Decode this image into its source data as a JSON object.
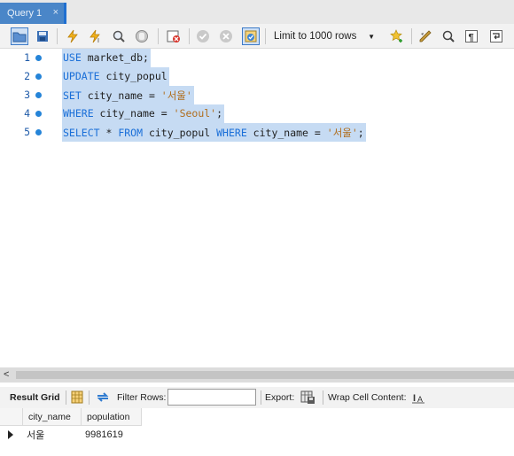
{
  "tab": {
    "title": "Query 1",
    "close": "×"
  },
  "toolbar": {
    "limit_label": "Limit to 1000 rows",
    "icons": [
      "open-folder-icon",
      "save-icon",
      "execute-icon",
      "execute-current-icon",
      "explain-icon",
      "stop-icon",
      "toggle-error-icon",
      "commit-icon",
      "rollback-icon",
      "autocommit-icon",
      "add-snippet-icon",
      "beautify-icon",
      "find-icon",
      "invisible-chars-icon",
      "wrap-icon"
    ]
  },
  "editor": {
    "lines": [
      {
        "num": "1",
        "tokens": [
          {
            "t": "USE",
            "c": "kw"
          },
          {
            "t": " market_db;",
            "c": ""
          }
        ]
      },
      {
        "num": "2",
        "tokens": [
          {
            "t": "UPDATE",
            "c": "kw"
          },
          {
            "t": " city_popul",
            "c": ""
          }
        ]
      },
      {
        "num": "3",
        "tokens": [
          {
            "t": "SET",
            "c": "kw"
          },
          {
            "t": " city_name = ",
            "c": ""
          },
          {
            "t": "'서울'",
            "c": "str"
          }
        ]
      },
      {
        "num": "4",
        "tokens": [
          {
            "t": "WHERE",
            "c": "kw"
          },
          {
            "t": " city_name = ",
            "c": ""
          },
          {
            "t": "'Seoul'",
            "c": "str"
          },
          {
            "t": ";",
            "c": ""
          }
        ]
      },
      {
        "num": "5",
        "tokens": [
          {
            "t": "SELECT",
            "c": "kw"
          },
          {
            "t": " * ",
            "c": ""
          },
          {
            "t": "FROM",
            "c": "kw"
          },
          {
            "t": " city_popul ",
            "c": ""
          },
          {
            "t": "WHERE",
            "c": "kw"
          },
          {
            "t": " city_name = ",
            "c": ""
          },
          {
            "t": "'서울'",
            "c": "str"
          },
          {
            "t": ";",
            "c": ""
          }
        ]
      }
    ]
  },
  "results": {
    "result_grid_label": "Result Grid",
    "filter_label": "Filter Rows:",
    "export_label": "Export:",
    "wrap_label": "Wrap Cell Content:",
    "columns": [
      "city_name",
      "population"
    ],
    "rows": [
      [
        "서울",
        "9981619"
      ]
    ]
  },
  "colors": {
    "accent": "#4a86c8",
    "keyword": "#1a6fd8",
    "string": "#b06e1e",
    "selection": "#c6dbf3"
  }
}
